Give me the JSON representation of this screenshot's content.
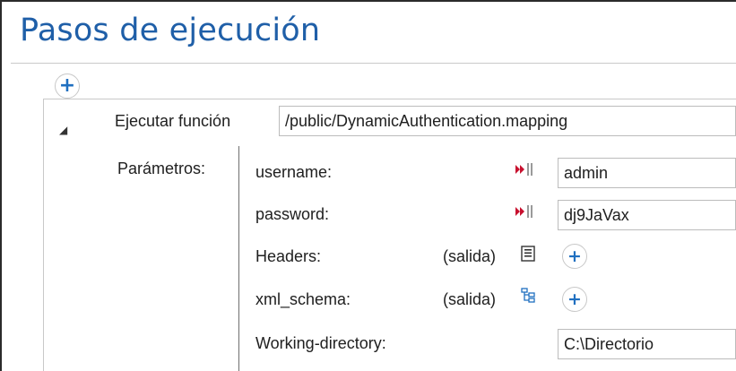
{
  "title": "Pasos de ejecución",
  "step": {
    "label": "Ejecutar función",
    "path": "/public/DynamicAuthentication.mapping"
  },
  "params_label": "Parámetros:",
  "parameters": [
    {
      "name": "username:",
      "value": "admin"
    },
    {
      "name": "password:",
      "value": "dj9JaVax"
    },
    {
      "name": "Headers:",
      "kind": "(salida)"
    },
    {
      "name": "xml_schema:",
      "kind": "(salida)"
    },
    {
      "name": "Working-directory:",
      "value": "C:\\Directorio"
    }
  ],
  "icons": {
    "add": "plus-icon",
    "collapse": "collapse-triangle-icon",
    "mapping": "mapping-input-icon",
    "document": "document-icon",
    "schema": "xml-schema-icon"
  },
  "colors": {
    "title": "#1f5fa8",
    "accent": "#1f6fc0",
    "mapping_red": "#c8102e"
  }
}
